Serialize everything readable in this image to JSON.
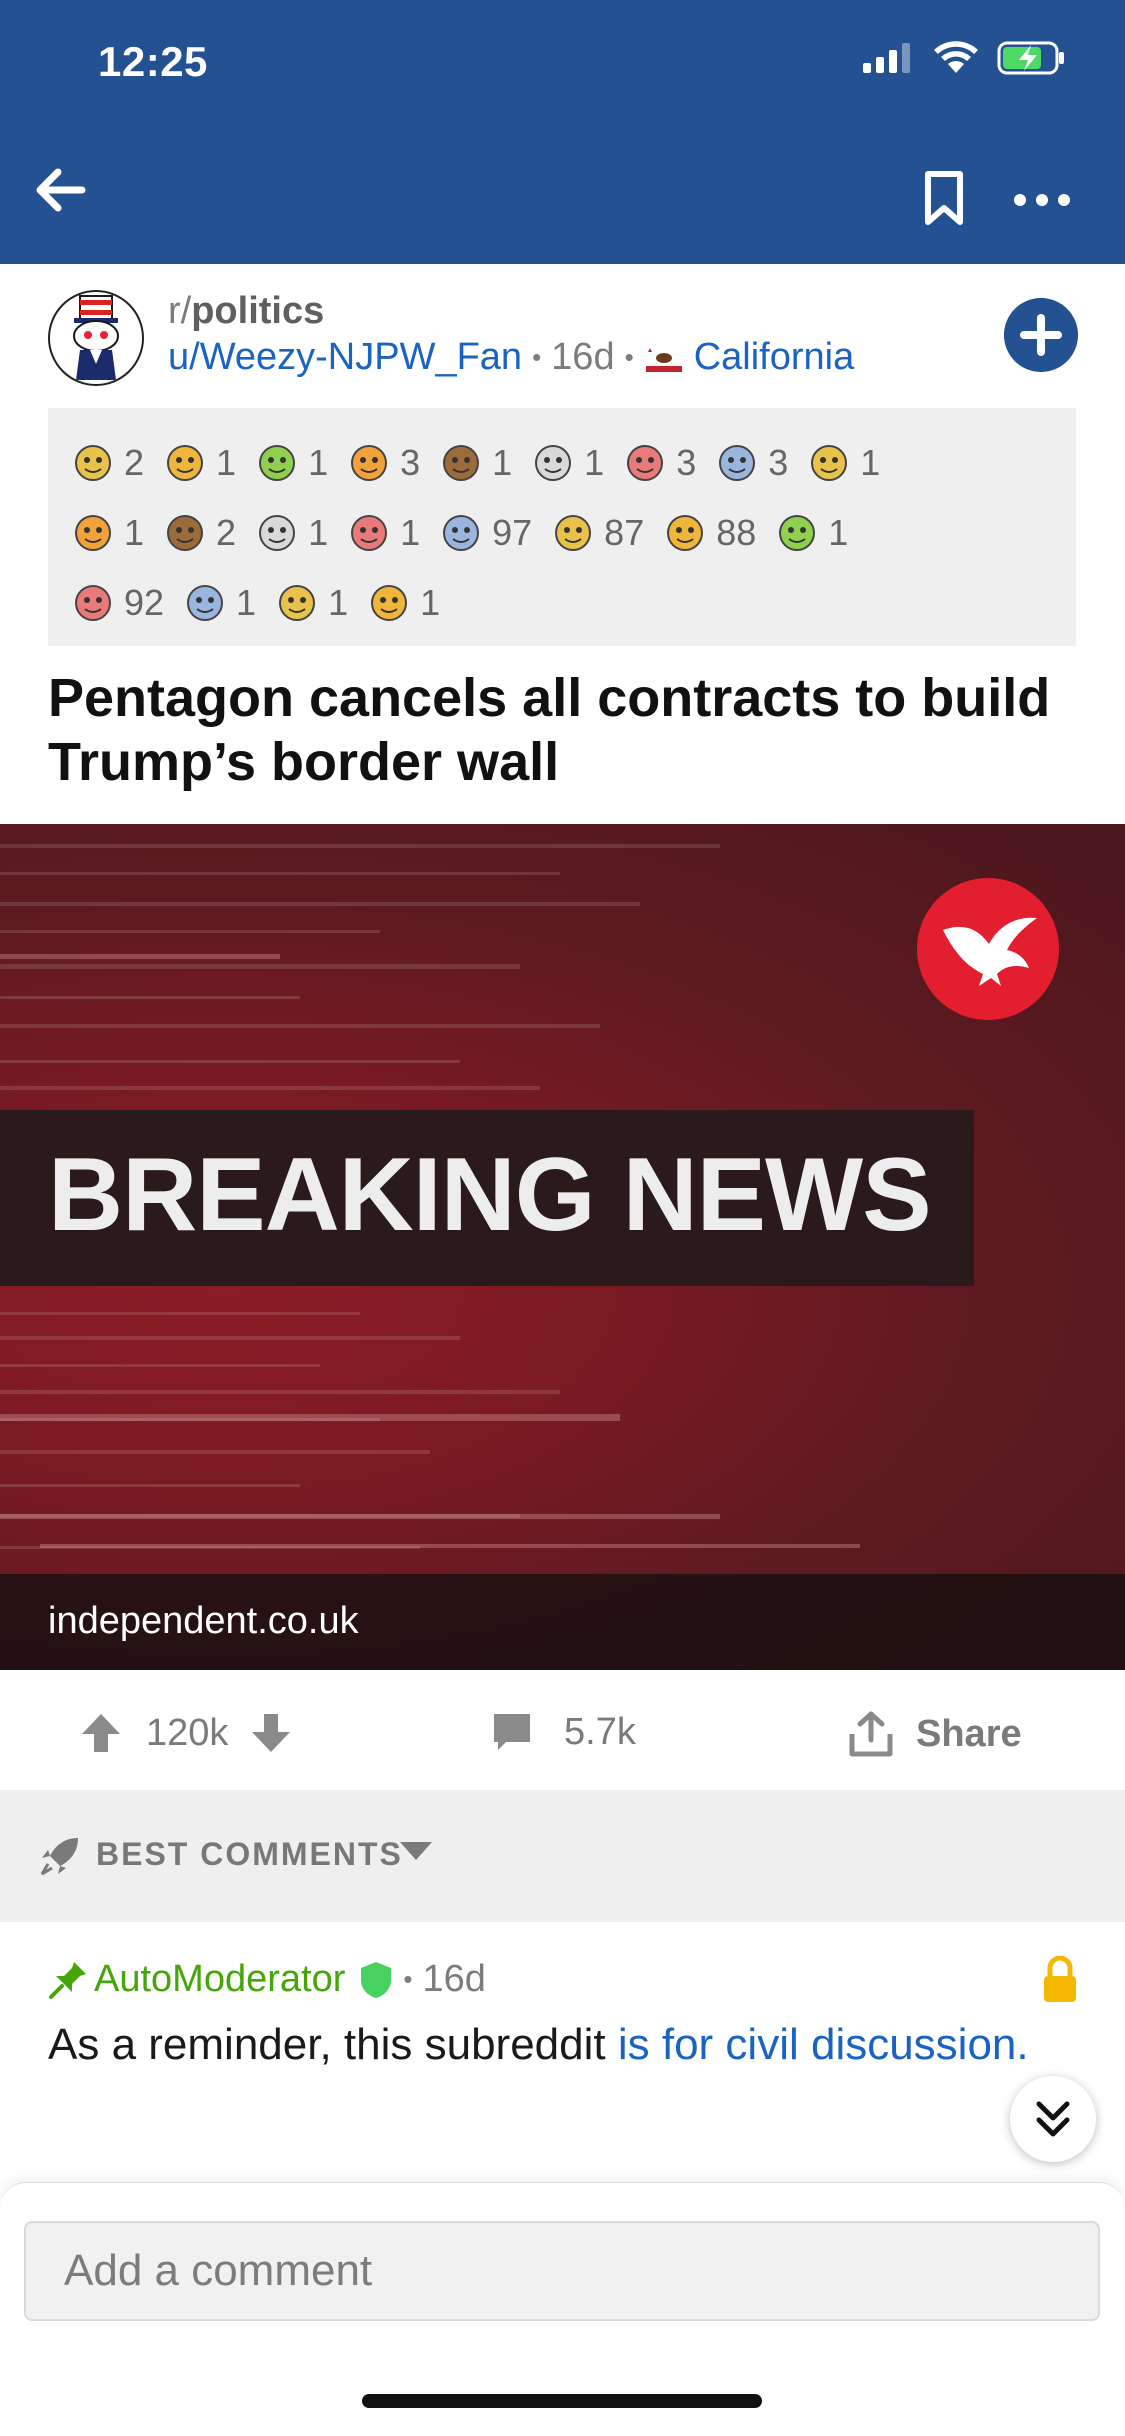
{
  "status_bar": {
    "time": "12:25"
  },
  "post": {
    "subreddit_prefix": "r/",
    "subreddit": "politics",
    "author": "u/Weezy-NJPW_Fan",
    "age": "16d",
    "flair": "California",
    "separator": "•",
    "title": "Pentagon cancels all contracts to build Trump’s border wall",
    "image_headline": "BREAKING NEWS",
    "domain": "independent.co.uk"
  },
  "awards": [
    [
      {
        "icon": "award-icon",
        "count": "2"
      },
      {
        "icon": "award-icon",
        "count": "1"
      },
      {
        "icon": "award-icon",
        "count": "1"
      },
      {
        "icon": "award-icon",
        "count": "3"
      },
      {
        "icon": "award-icon",
        "count": "1"
      },
      {
        "icon": "award-icon",
        "count": "1"
      },
      {
        "icon": "award-icon",
        "count": "3"
      },
      {
        "icon": "award-icon",
        "count": "3"
      },
      {
        "icon": "award-icon",
        "count": "1"
      }
    ],
    [
      {
        "icon": "award-icon",
        "count": "1"
      },
      {
        "icon": "award-icon",
        "count": "2"
      },
      {
        "icon": "award-icon",
        "count": "1"
      },
      {
        "icon": "award-icon",
        "count": "1"
      },
      {
        "icon": "award-icon",
        "count": "97"
      },
      {
        "icon": "award-icon",
        "count": "87"
      },
      {
        "icon": "award-icon",
        "count": "88"
      },
      {
        "icon": "award-icon",
        "count": "1"
      }
    ],
    [
      {
        "icon": "award-icon",
        "count": "92"
      },
      {
        "icon": "award-icon",
        "count": "1"
      },
      {
        "icon": "award-icon",
        "count": "1"
      },
      {
        "icon": "award-icon",
        "count": "1"
      }
    ]
  ],
  "actions": {
    "votes": "120k",
    "comments": "5.7k",
    "share": "Share"
  },
  "sort": {
    "label": "BEST COMMENTS"
  },
  "comment": {
    "author": "AutoModerator",
    "age": "16d",
    "separator": "•",
    "body_prefix": "As a reminder, this subreddit ",
    "body_link": "is for civil discussion."
  },
  "comment_input": {
    "placeholder": "Add a comment"
  },
  "colors": {
    "header_bg": "#235192",
    "link_blue": "#1a63c2",
    "mod_green": "#46a508",
    "lock_gold": "#f5b800",
    "logo_red": "#e21e2f"
  }
}
